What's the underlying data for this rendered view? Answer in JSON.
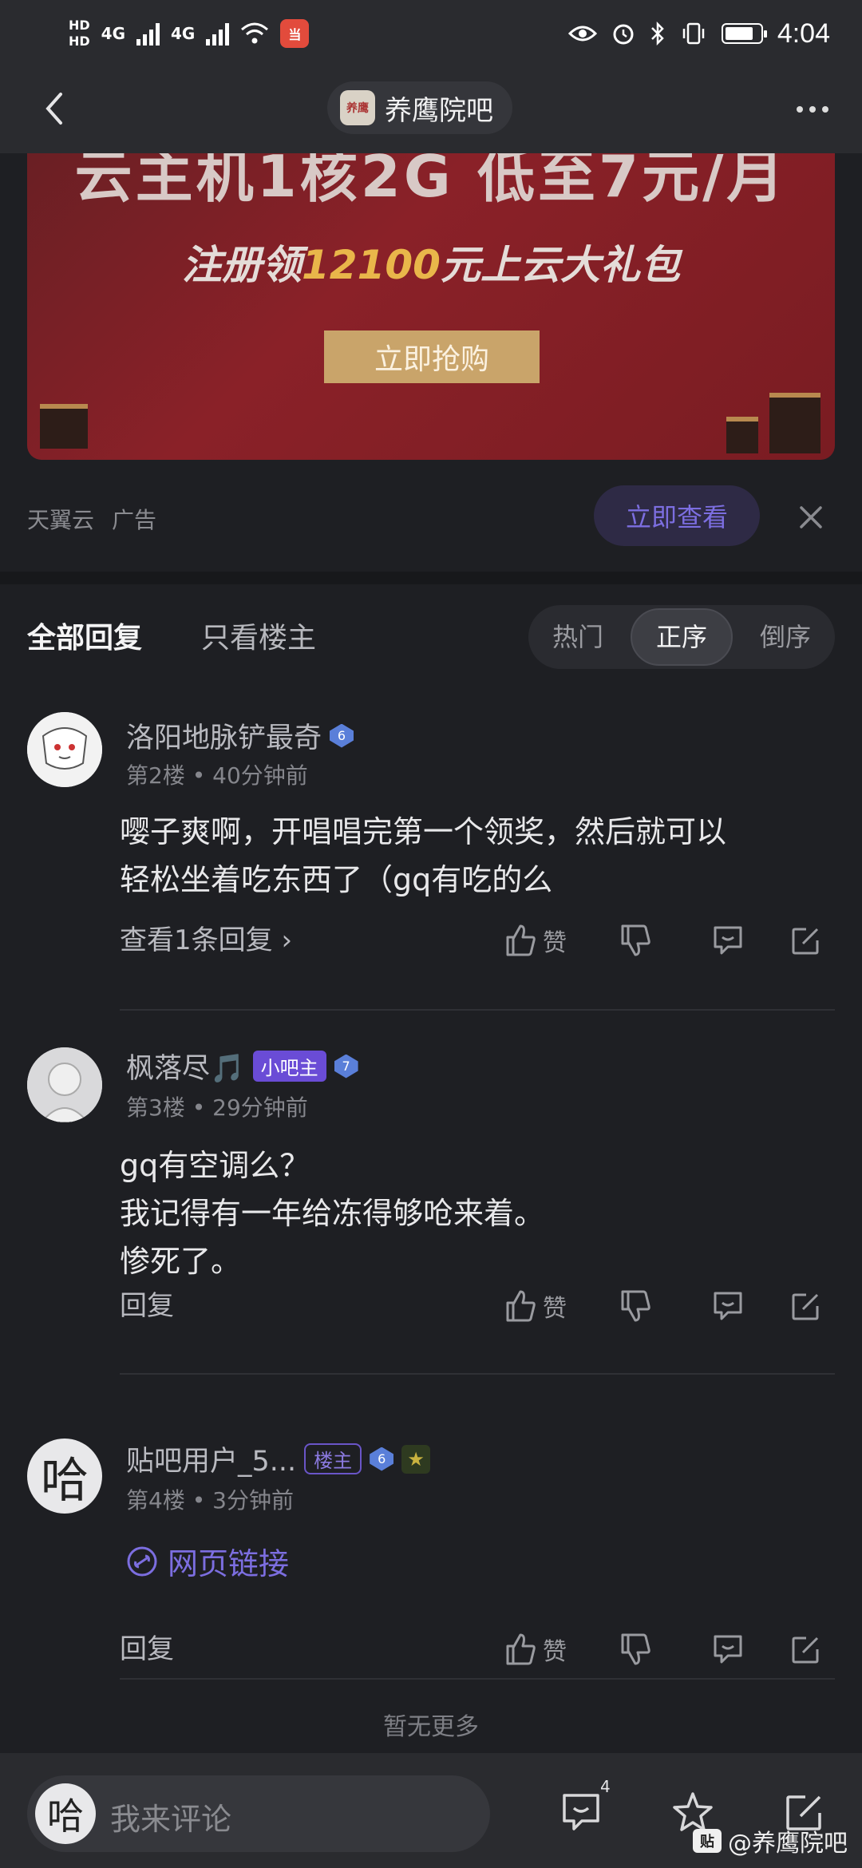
{
  "status": {
    "hd1": "HD",
    "hd2": "HD",
    "net1": "4G",
    "net2": "4G",
    "app_badge": "当",
    "time": "4:04"
  },
  "nav": {
    "title": "养鹰院吧",
    "avatar_text": "养鹰"
  },
  "ad": {
    "headline": "云主机1核2G 低至7元/月",
    "sub_prefix": "注册领",
    "sub_amount": "12100",
    "sub_suffix": "元上云大礼包",
    "button": "立即抢购",
    "source": "天翼云",
    "tag": "广告",
    "cta": "立即查看"
  },
  "tabs": {
    "all": "全部回复",
    "only_lz": "只看楼主",
    "sort": [
      "热门",
      "正序",
      "倒序"
    ]
  },
  "posts": [
    {
      "user": "洛阳地脉铲最奇",
      "level": "6",
      "floor": "第2楼",
      "time": "40分钟前",
      "lines": [
        "嘤子爽啊，开唱唱完第一个领奖，然后就可以",
        "轻松坐着吃东西了（gq有吃的么"
      ],
      "reply_label": "查看1条回复",
      "like": "赞"
    },
    {
      "user": "枫落尽🎵",
      "admin_badge": "小吧主",
      "level": "7",
      "floor": "第3楼",
      "time": "29分钟前",
      "lines": [
        "gq有空调么？",
        "我记得有一年给冻得够呛来着。",
        "惨死了。"
      ],
      "reply_label": "回复",
      "like": "赞"
    },
    {
      "user": "贴吧用户_5...",
      "lz_badge": "楼主",
      "level": "6",
      "floor": "第4楼",
      "time": "3分钟前",
      "link": "网页链接",
      "reply_label": "回复",
      "like": "赞",
      "avatar_text": "哈"
    }
  ],
  "dot": "•",
  "no_more": "暂无更多",
  "bottom": {
    "placeholder": "我来评论",
    "avatar_text": "哈",
    "comment_count": "4",
    "watermark_icon": "贴",
    "watermark": "@养鹰院吧"
  }
}
